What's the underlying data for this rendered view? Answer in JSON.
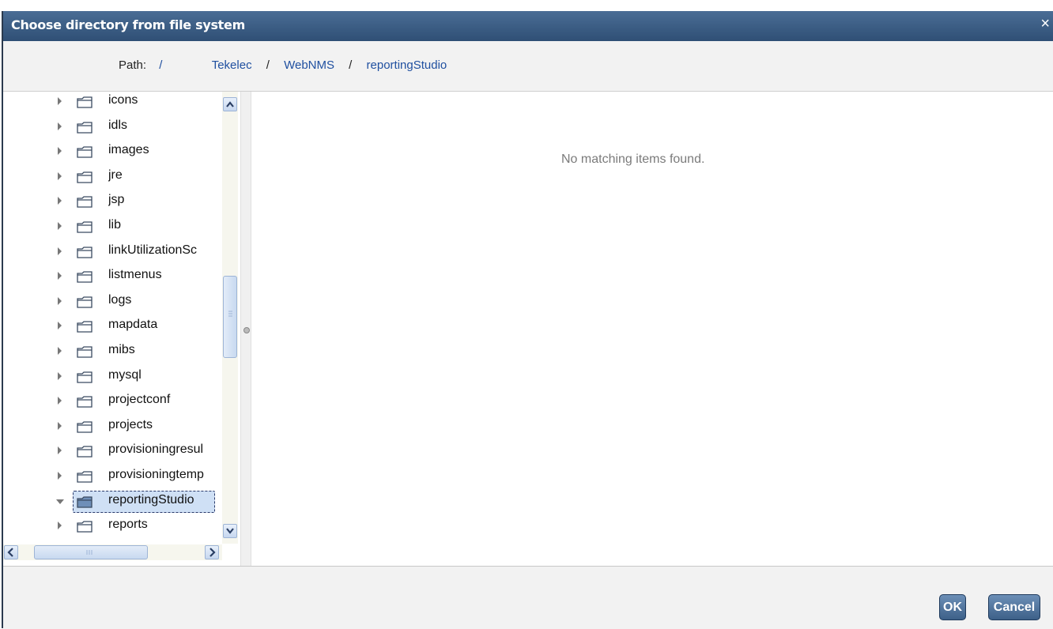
{
  "dialog": {
    "title": "Choose directory from file system",
    "close_label": "×"
  },
  "path": {
    "label": "Path:",
    "root": "/",
    "separator": "/",
    "segments": [
      "Tekelec",
      "WebNMS",
      "reportingStudio"
    ]
  },
  "tree": {
    "items": [
      {
        "label": "icons",
        "expanded": false,
        "selected": false
      },
      {
        "label": "idls",
        "expanded": false,
        "selected": false
      },
      {
        "label": "images",
        "expanded": false,
        "selected": false
      },
      {
        "label": "jre",
        "expanded": false,
        "selected": false
      },
      {
        "label": "jsp",
        "expanded": false,
        "selected": false
      },
      {
        "label": "lib",
        "expanded": false,
        "selected": false
      },
      {
        "label": "linkUtilizationSc",
        "expanded": false,
        "selected": false
      },
      {
        "label": "listmenus",
        "expanded": false,
        "selected": false
      },
      {
        "label": "logs",
        "expanded": false,
        "selected": false
      },
      {
        "label": "mapdata",
        "expanded": false,
        "selected": false
      },
      {
        "label": "mibs",
        "expanded": false,
        "selected": false
      },
      {
        "label": "mysql",
        "expanded": false,
        "selected": false
      },
      {
        "label": "projectconf",
        "expanded": false,
        "selected": false
      },
      {
        "label": "projects",
        "expanded": false,
        "selected": false
      },
      {
        "label": "provisioningresul",
        "expanded": false,
        "selected": false
      },
      {
        "label": "provisioningtemp",
        "expanded": false,
        "selected": false
      },
      {
        "label": "reportingStudio",
        "expanded": true,
        "selected": true
      },
      {
        "label": "reports",
        "expanded": false,
        "selected": false
      }
    ],
    "vertical_scroll_fraction": 0.5,
    "horizontal_scroll_fraction": 0.0
  },
  "content": {
    "empty_message": "No matching items found."
  },
  "footer": {
    "ok_label": "OK",
    "cancel_label": "Cancel"
  },
  "colors": {
    "titlebar": "#3a5d86",
    "link": "#2050a0",
    "button": "#4f729b"
  },
  "icons": {
    "folder": "folder-icon",
    "expand": "triangle-right-icon",
    "collapse": "triangle-down-icon"
  }
}
